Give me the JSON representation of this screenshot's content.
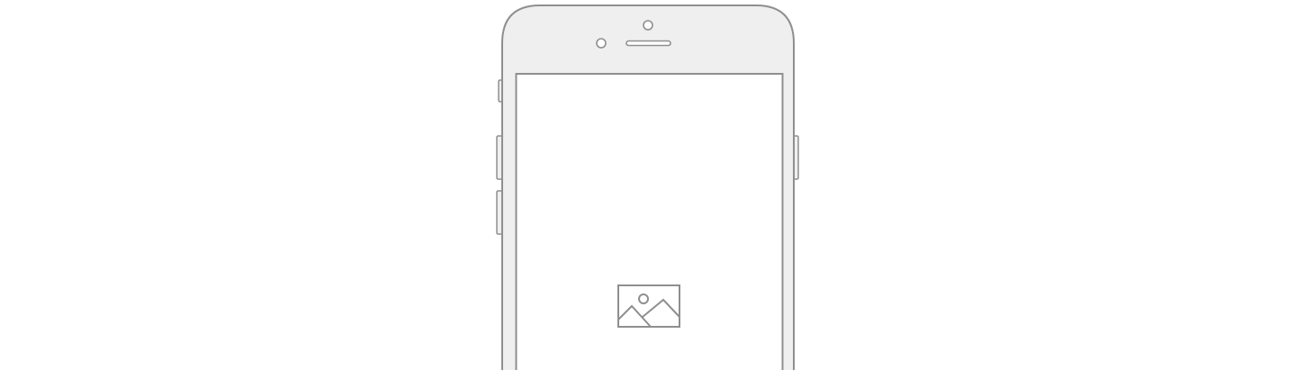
{
  "device": {
    "type": "smartphone",
    "colors": {
      "body_fill": "#efefef",
      "outline": "#8f8f8f",
      "screen_fill": "#ffffff",
      "background": "#ffffff"
    },
    "icons": {
      "front_camera": "front-camera-icon",
      "proximity_sensor": "sensor-icon",
      "earpiece": "speaker-grille-icon",
      "placeholder": "image-placeholder-icon"
    }
  }
}
